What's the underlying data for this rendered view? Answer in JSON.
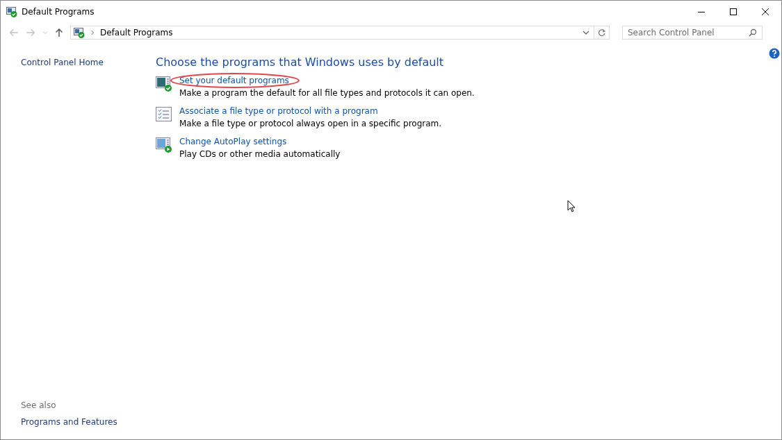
{
  "window": {
    "title": "Default Programs"
  },
  "address_bar": {
    "path": "Default Programs"
  },
  "search": {
    "placeholder": "Search Control Panel"
  },
  "sidebar": {
    "home_link": "Control Panel Home",
    "see_also_heading": "See also",
    "see_also_links": [
      "Programs and Features"
    ]
  },
  "content": {
    "heading": "Choose the programs that Windows uses by default",
    "tasks": [
      {
        "kind": "default",
        "link": "Set your default programs",
        "description": "Make a program the default for all file types and protocols it can open.",
        "highlighted": true
      },
      {
        "kind": "associate",
        "link": "Associate a file type or protocol with a program",
        "description": "Make a file type or protocol always open in a specific program.",
        "highlighted": false
      },
      {
        "kind": "autoplay",
        "link": "Change AutoPlay settings",
        "description": "Play CDs or other media automatically",
        "highlighted": false
      }
    ]
  }
}
